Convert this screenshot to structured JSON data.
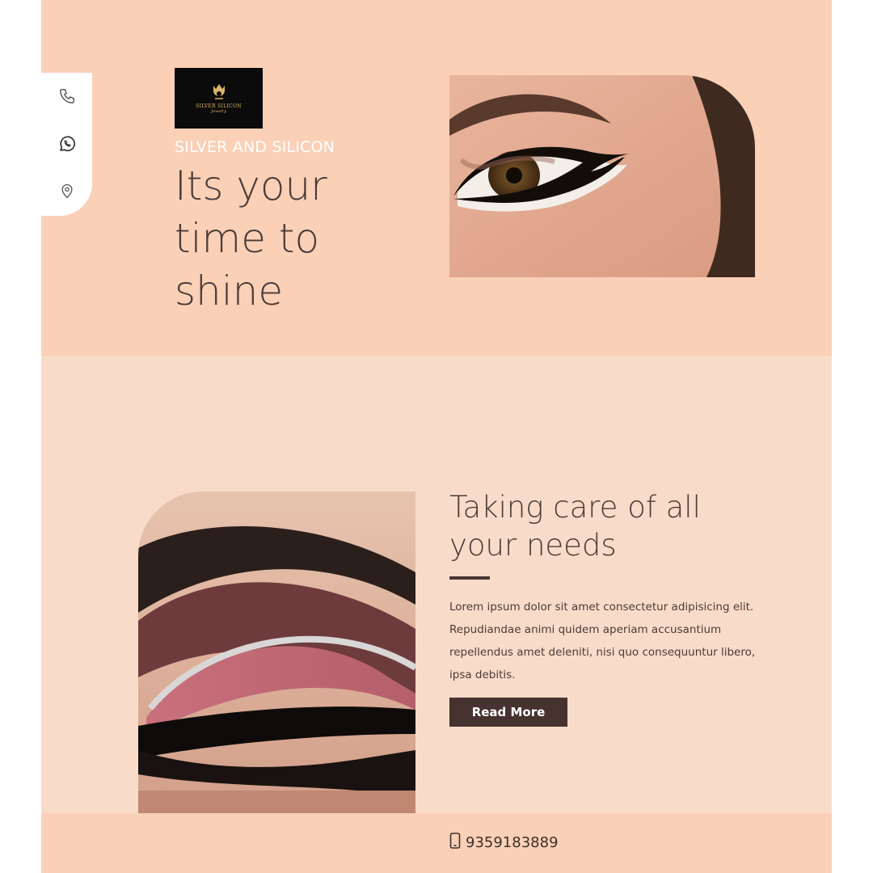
{
  "colors": {
    "hero_bg": "#fad0b7",
    "section_bg": "#f9dbc9",
    "heading_text": "#4a3b37",
    "button_bg": "#46332f",
    "brand_text": "#ffffff"
  },
  "contact_rail": {
    "icons": [
      "phone-icon",
      "whatsapp-icon",
      "location-pin-icon"
    ]
  },
  "logo": {
    "line1": "SILVER SILICON",
    "line2": "Jewelry"
  },
  "hero": {
    "brand": "SILVER AND SILICON",
    "headline": "Its your time to shine"
  },
  "about": {
    "title": "Taking care of all your needs",
    "body": "Lorem ipsum dolor sit amet consectetur adipisicing elit. Repudiandae animi quidem aperiam accusantium repellendus amet deleniti, nisi quo consequuntur libero, ipsa debitis.",
    "button_label": "Read More"
  },
  "footer": {
    "phone_icon": "mobile-phone-icon",
    "phone": "9359183889"
  }
}
